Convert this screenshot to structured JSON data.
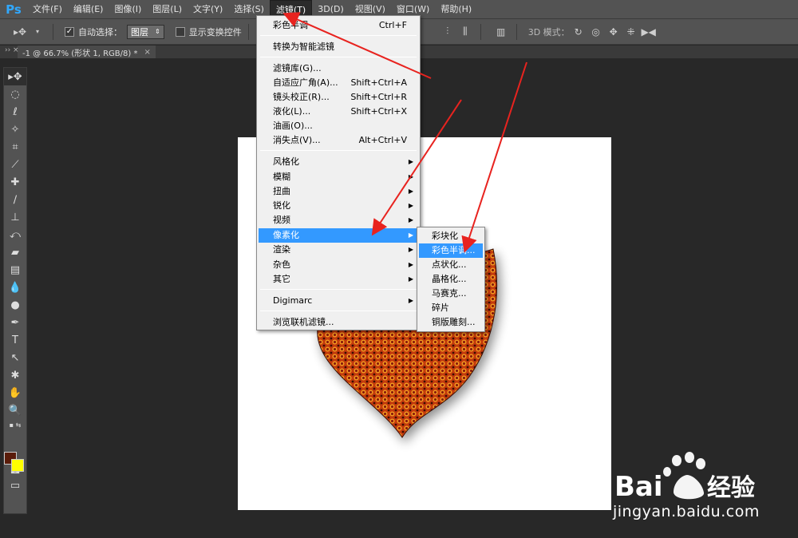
{
  "app": {
    "logo": "Ps"
  },
  "menubar": {
    "items": [
      "文件(F)",
      "编辑(E)",
      "图像(I)",
      "图层(L)",
      "文字(Y)",
      "选择(S)",
      "滤镜(T)",
      "3D(D)",
      "视图(V)",
      "窗口(W)",
      "帮助(H)"
    ],
    "active_index": 6
  },
  "options": {
    "auto_select_label": "自动选择：",
    "auto_select_checked": true,
    "auto_select_value": "图层",
    "show_transform_label": "显示变换控件",
    "mode_3d_label": "3D 模式："
  },
  "document_tab": {
    "title": "-1 @ 66.7% (形状 1, RGB/8) *",
    "close": "×"
  },
  "filter_menu": {
    "items": [
      {
        "label": "彩色半调",
        "shortcut": "Ctrl+F"
      },
      {
        "label": "转换为智能滤镜"
      },
      {
        "label": "滤镜库(G)..."
      },
      {
        "label": "自适应广角(A)...",
        "shortcut": "Shift+Ctrl+A"
      },
      {
        "label": "镜头校正(R)...",
        "shortcut": "Shift+Ctrl+R"
      },
      {
        "label": "液化(L)...",
        "shortcut": "Shift+Ctrl+X"
      },
      {
        "label": "油画(O)..."
      },
      {
        "label": "消失点(V)...",
        "shortcut": "Alt+Ctrl+V"
      },
      {
        "label": "风格化",
        "submenu": true
      },
      {
        "label": "模糊",
        "submenu": true
      },
      {
        "label": "扭曲",
        "submenu": true
      },
      {
        "label": "锐化",
        "submenu": true
      },
      {
        "label": "视频",
        "submenu": true
      },
      {
        "label": "像素化",
        "submenu": true,
        "highlighted": true
      },
      {
        "label": "渲染",
        "submenu": true
      },
      {
        "label": "杂色",
        "submenu": true
      },
      {
        "label": "其它",
        "submenu": true
      },
      {
        "label": "Digimarc",
        "submenu": true
      },
      {
        "label": "浏览联机滤镜..."
      }
    ]
  },
  "pixelate_submenu": {
    "items": [
      "彩块化",
      "彩色半调...",
      "点状化...",
      "晶格化...",
      "马赛克...",
      "碎片",
      "铜版雕刻..."
    ],
    "highlighted_index": 1
  },
  "colors": {
    "foreground": "#5a1c0a",
    "background": "#ffff00",
    "highlight": "#3399ff",
    "arrow": "#e8231f"
  },
  "watermark": {
    "brand_left": "Bai",
    "brand_right": "经验",
    "url": "jingyan.baidu.com"
  }
}
